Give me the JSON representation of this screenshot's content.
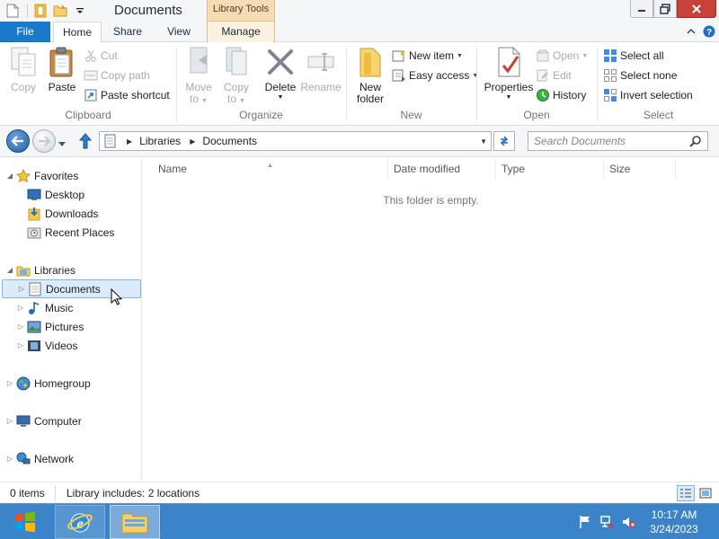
{
  "window": {
    "title": "Documents",
    "context_tab_group": "Library Tools"
  },
  "ribbon_tabs": {
    "file": "File",
    "home": "Home",
    "share": "Share",
    "view": "View",
    "manage": "Manage"
  },
  "clipboard": {
    "copy": "Copy",
    "paste": "Paste",
    "cut": "Cut",
    "copy_path": "Copy path",
    "paste_shortcut": "Paste shortcut",
    "label": "Clipboard"
  },
  "organize": {
    "move_to": "Move\nto",
    "copy_to": "Copy\nto",
    "delete": "Delete",
    "rename": "Rename",
    "label": "Organize"
  },
  "new": {
    "new_folder": "New\nfolder",
    "new_item": "New item",
    "easy_access": "Easy access",
    "label": "New"
  },
  "open": {
    "properties": "Properties",
    "open": "Open",
    "edit": "Edit",
    "history": "History",
    "label": "Open"
  },
  "select": {
    "select_all": "Select all",
    "select_none": "Select none",
    "invert_selection": "Invert selection",
    "label": "Select"
  },
  "address": {
    "crumbs": [
      "Libraries",
      "Documents"
    ]
  },
  "search": {
    "placeholder": "Search Documents"
  },
  "nav_pane": {
    "favorites": {
      "label": "Favorites",
      "items": [
        "Desktop",
        "Downloads",
        "Recent Places"
      ]
    },
    "libraries": {
      "label": "Libraries",
      "items": [
        "Documents",
        "Music",
        "Pictures",
        "Videos"
      ]
    },
    "homegroup": "Homegroup",
    "computer": "Computer",
    "network": "Network"
  },
  "columns": [
    "Name",
    "Date modified",
    "Type",
    "Size"
  ],
  "empty_message": "This folder is empty.",
  "status": {
    "item_count": "0 items",
    "library_info": "Library includes: 2 locations"
  },
  "taskbar": {
    "time": "10:17 AM",
    "date": "3/24/2023"
  },
  "colors": {
    "accent": "#1979ca",
    "taskbar": "#3b84ca",
    "library_tools": "#f5dcb6",
    "close_button": "#c7433a",
    "selection": "#dcebfc"
  }
}
